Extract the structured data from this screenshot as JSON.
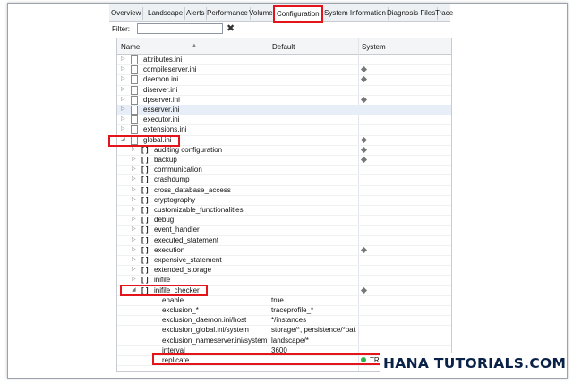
{
  "tabs": [
    {
      "label": "Overview",
      "active": false
    },
    {
      "label": "Landscape",
      "active": false
    },
    {
      "label": "Alerts",
      "active": false
    },
    {
      "label": "Performance",
      "active": false
    },
    {
      "label": "Volumes",
      "active": false
    },
    {
      "label": "Configuration",
      "active": true
    },
    {
      "label": "System Information",
      "active": false
    },
    {
      "label": "Diagnosis Files",
      "active": false
    },
    {
      "label": "Trace",
      "active": false
    }
  ],
  "filter": {
    "label": "Filter:",
    "value": ""
  },
  "columns": {
    "name": "Name",
    "default": "Default",
    "system": "System"
  },
  "rows": [
    {
      "name": "attributes.ini"
    },
    {
      "name": "compileserver.ini"
    },
    {
      "name": "daemon.ini"
    },
    {
      "name": "diserver.ini"
    },
    {
      "name": "dpserver.ini"
    },
    {
      "name": "esserver.ini"
    },
    {
      "name": "executor.ini"
    },
    {
      "name": "extensions.ini"
    },
    {
      "name": "global.ini"
    },
    {
      "name": "auditing configuration"
    },
    {
      "name": "backup"
    },
    {
      "name": "communication"
    },
    {
      "name": "crashdump"
    },
    {
      "name": "cross_database_access"
    },
    {
      "name": "cryptography"
    },
    {
      "name": "customizable_functionalities"
    },
    {
      "name": "debug"
    },
    {
      "name": "event_handler"
    },
    {
      "name": "executed_statement"
    },
    {
      "name": "execution"
    },
    {
      "name": "expensive_statement"
    },
    {
      "name": "extended_storage"
    },
    {
      "name": "inifile"
    },
    {
      "name": "inifile_checker"
    },
    {
      "name": "enable",
      "default": "true"
    },
    {
      "name": "exclusion_*",
      "default": "traceprofile_*"
    },
    {
      "name": "exclusion_daemon.ini/host",
      "default": "*/instances"
    },
    {
      "name": "exclusion_global.ini/system",
      "default": "storage/*, persistence/*pat..."
    },
    {
      "name": "exclusion_nameserver.ini/system",
      "default": "landscape/*"
    },
    {
      "name": "interval",
      "default": "3600"
    },
    {
      "name": "replicate",
      "system": "TRUE"
    }
  ],
  "watermark": "HANA TUTORIALS.COM"
}
